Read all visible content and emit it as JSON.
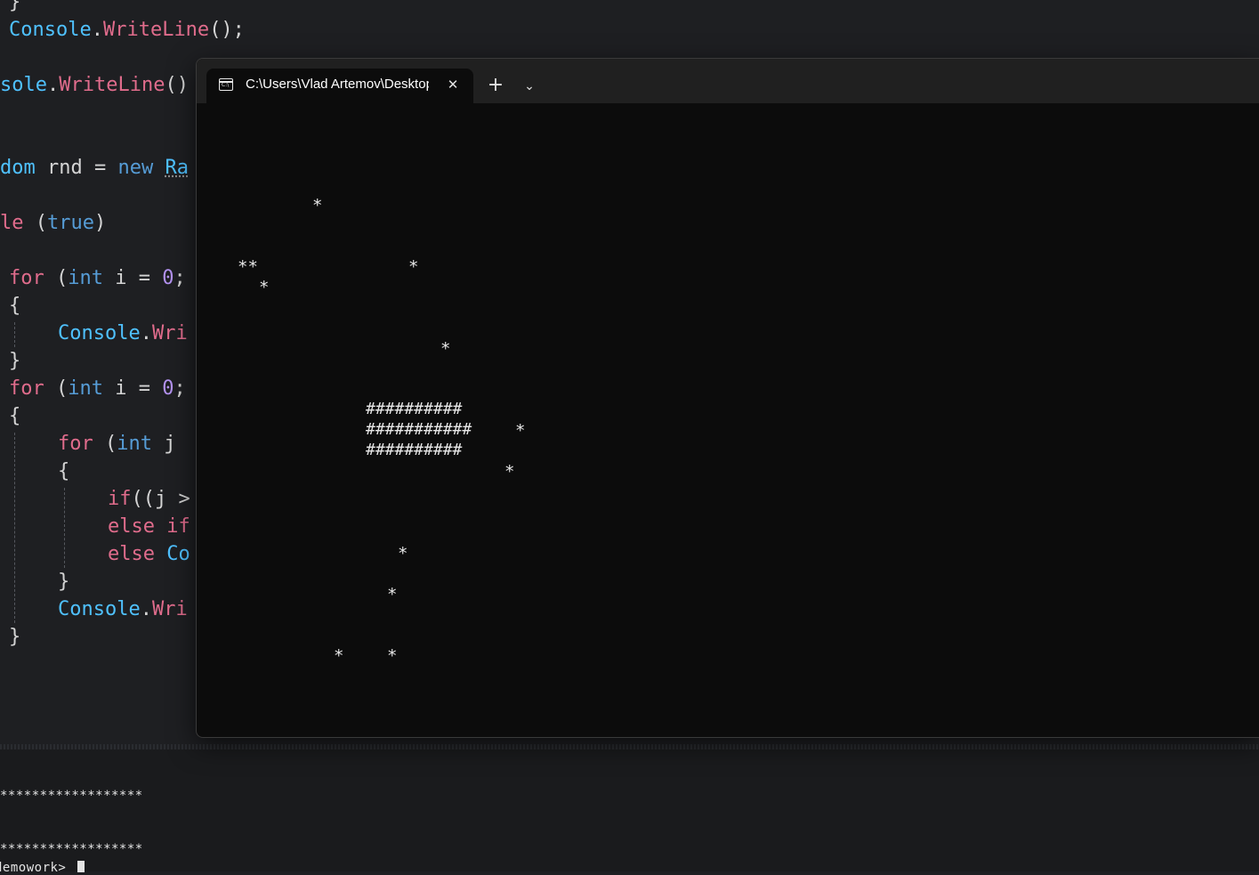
{
  "editor": {
    "lines": {
      "l1": "}",
      "l2_a": "Console",
      "l2_b": ".",
      "l2_c": "WriteLine",
      "l2_d": "();",
      "l3_a": "sole",
      "l3_b": ".",
      "l3_c": "WriteLine",
      "l3_d": "()",
      "l4_a": "dom",
      "l4_b": " rnd = ",
      "l4_c": "new",
      "l4_d": " ",
      "l4_e": "Ra",
      "l5_a": "le",
      "l5_b": " (",
      "l5_c": "true",
      "l5_d": ")",
      "l6_a": "for",
      "l6_b": " (",
      "l6_c": "int",
      "l6_d": " i = ",
      "l6_e": "0",
      "l6_f": ";",
      "l7": "{",
      "l8_a": "Console",
      "l8_b": ".",
      "l8_c": "Wri",
      "l9": "}",
      "l10_a": "for",
      "l10_b": " (",
      "l10_c": "int",
      "l10_d": " i = ",
      "l10_e": "0",
      "l10_f": ";",
      "l11": "{",
      "l12_a": "for",
      "l12_b": " (",
      "l12_c": "int",
      "l12_d": " j ",
      "l13": "{",
      "l14_a": "if",
      "l14_b": "((j >",
      "l15_a": "else",
      "l15_b": " ",
      "l15_c": "if",
      "l16_a": "else",
      "l16_b": " ",
      "l16_c": "Co",
      "l17": "}",
      "l18_a": "Console",
      "l18_b": ".",
      "l18_c": "Wri",
      "l19": "}"
    }
  },
  "bottom_panel": {
    "line1": "******************",
    "line2": "******************",
    "prompt": "demowork> "
  },
  "terminal": {
    "tab_title": "C:\\Users\\Vlad Artemov\\Desktop",
    "tab_icon_text": "C:\\",
    "close_glyph": "✕",
    "new_tab_glyph": "+",
    "menu_glyph": "⌄",
    "output": {
      "s1": "*",
      "s2": "**",
      "s3": "*",
      "s4": "*",
      "s5": "*",
      "h1": "##########",
      "h2": "###########",
      "s6": "*",
      "h3": "##########",
      "s7": "*",
      "s8": "*",
      "s9": "*",
      "s10": "*",
      "s11": "*"
    }
  },
  "colors": {
    "editor_bg": "#1e1f22",
    "terminal_bg": "#0c0c0c",
    "keyword": "#e06c8c",
    "type": "#569cd6",
    "class": "#4fc1ff",
    "number": "#b392f0"
  }
}
